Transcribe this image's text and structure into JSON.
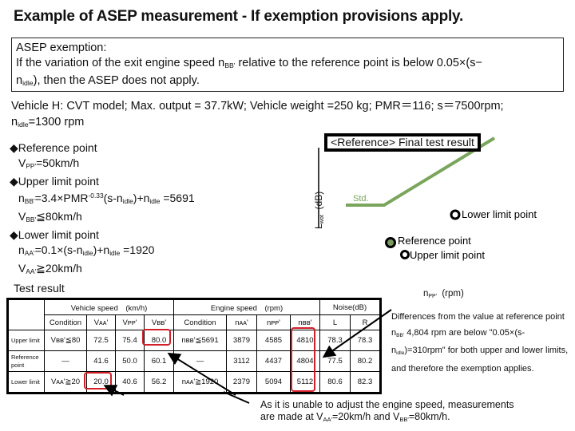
{
  "title": "Example of ASEP measurement - If exemption provisions apply.",
  "exemption_box": {
    "heading": "ASEP exemption:",
    "line1_a": "If the variation of the exit engine speed n",
    "line1_sub": "BB'",
    "line1_b": " relative to the reference point is below 0.05×(s−",
    "line2_a": "n",
    "line2_sub": "idle",
    "line2_b": "), then the ASEP does not apply."
  },
  "vehicle_info": {
    "line1": "Vehicle H: CVT model;  Max. output = 37.7kW; Vehicle weight =250 kg; PMR＝116; s＝7500rpm;",
    "line2_n": "n",
    "line2_sub": "idle",
    "line2_rest": "=1300 rpm"
  },
  "points": {
    "reference_heading": "◆Reference point",
    "reference_v": "V",
    "reference_v_sub": "PP'",
    "reference_v_val": "=50km/h",
    "upper_heading": "◆Upper limit point",
    "upper_formula_n": "n",
    "upper_formula_n_sub": "BB'",
    "upper_formula_a": "=3.4×PMR",
    "upper_formula_exp": "-0.33",
    "upper_formula_b": "(s-n",
    "upper_formula_idle": "idle",
    "upper_formula_c": ")+n",
    "upper_formula_d": " =5691",
    "upper_v": "V",
    "upper_v_sub": "BB'",
    "upper_v_val": "≦80km/h",
    "lower_heading": "◆Lower limit point",
    "lower_formula_n": "n",
    "lower_formula_n_sub": "AA'",
    "lower_formula_a": "=0.1×(s-n",
    "lower_formula_idle": "idle",
    "lower_formula_b": ")+n",
    "lower_formula_c": " =1920",
    "lower_v": "V",
    "lower_v_sub": "AA'",
    "lower_v_val": "≧20km/h"
  },
  "chart": {
    "reference_tag": "<Reference> Final test result",
    "ylabel_main": "L",
    "ylabel_sub": "wot",
    "ylabel_unit": "(dB)",
    "std_label": "Std.",
    "x_label_n": "n",
    "x_label_sub": "PP'",
    "x_label_unit": "(rpm)",
    "std_color": "#7aa55c",
    "reference_fill": "#7a9a5e",
    "markers": [
      {
        "name": "Lower limit point",
        "rpm": 5112,
        "kind": "hollow"
      },
      {
        "name": "Reference point",
        "rpm": 4804,
        "kind": "filled"
      },
      {
        "name": "Upper limit point",
        "rpm": 4810,
        "kind": "hollow"
      }
    ]
  },
  "test_result": {
    "label": "Test result",
    "group_headers": [
      "",
      "Vehicle speed　(km/h)",
      "Engine speed　(rpm)",
      "Noise(dB)"
    ],
    "sub_headers": [
      "Condition",
      "Vᴀᴀ'",
      "Vᴘᴘ'",
      "Vʙʙ'",
      "Condition",
      "nᴀᴀ'",
      "nᴘᴘ'",
      "nʙʙ'",
      "L",
      "R"
    ],
    "rows": [
      {
        "label": "Upper limit",
        "cells": [
          "Vʙʙ'≦80",
          "72.5",
          "75.4",
          "80.0",
          "nʙʙ'≦5691",
          "3879",
          "4585",
          "4810",
          "78.3",
          "78.3"
        ]
      },
      {
        "label": "Reference point",
        "cells": [
          "—",
          "41.6",
          "50.0",
          "60.1",
          "—",
          "3112",
          "4437",
          "4804",
          "77.5",
          "80.2"
        ]
      },
      {
        "label": "Lower limit",
        "cells": [
          "Vᴀᴀ'≧20",
          "20.0",
          "40.6",
          "56.2",
          "nᴀᴀ'≧1920",
          "2379",
          "5094",
          "5112",
          "80.6",
          "82.3"
        ]
      }
    ],
    "highlight_color": "#d0202a"
  },
  "diff_note": {
    "a": "Differences from the value at reference point n",
    "sub1": "BB'",
    "b": " 4,804 rpm are below \"0.05×(s-n",
    "sub2": "idle",
    "c": ")=310rpm\" for both upper and lower limits, and therefore the exemption applies."
  },
  "final_note": {
    "line1": "As it is unable to adjust the engine speed, measurements",
    "line2_a": "are made at V",
    "line2_sub1": "AA'",
    "line2_b": "=20km/h and V",
    "line2_sub2": "BB'",
    "line2_c": "=80km/h."
  }
}
